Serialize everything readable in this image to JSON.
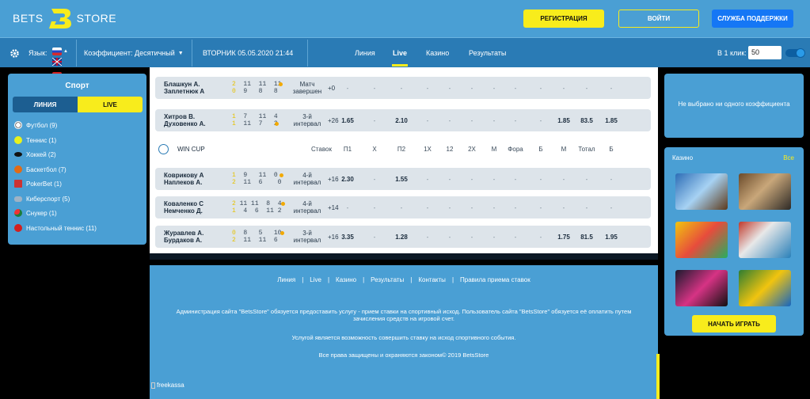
{
  "header": {
    "logo_left": "BETS",
    "logo_right": "STORE",
    "register_label": "РЕГИСТРАЦИЯ",
    "login_label": "ВОЙТИ",
    "support_label": "СЛУЖБА ПОДДЕРЖКИ",
    "colors": {
      "accent": "#f8ec1c",
      "header_bg": "#4a9fd4",
      "nav_bg": "#2a7bb5",
      "support": "#1577f5"
    }
  },
  "nav": {
    "language_label": "Язык:",
    "coef_label": "Коэффициент:",
    "coef_value": "Десятичный",
    "datetime": "ВТОРНИК 05.05.2020 21:44",
    "tabs": [
      {
        "label": "Линия"
      },
      {
        "label": "Live"
      },
      {
        "label": "Казино"
      },
      {
        "label": "Результаты"
      }
    ],
    "one_click_label": "В 1 клик:",
    "one_click_value": "50"
  },
  "sport_panel": {
    "title": "Спорт",
    "tabs": [
      "ЛИНИЯ",
      "LIVE"
    ],
    "items": [
      {
        "label": "Футбол (9)",
        "icon": "football-icon"
      },
      {
        "label": "Теннис (1)",
        "icon": "tennis-icon"
      },
      {
        "label": "Хоккей (2)",
        "icon": "hockey-icon"
      },
      {
        "label": "Баскетбол (7)",
        "icon": "basketball-icon"
      },
      {
        "label": "PokerBet (1)",
        "icon": "poker-icon"
      },
      {
        "label": "Киберспорт (5)",
        "icon": "esports-icon"
      },
      {
        "label": "Снукер (1)",
        "icon": "snooker-icon"
      },
      {
        "label": "Настольный теннис (11)",
        "icon": "table-tennis-icon"
      }
    ]
  },
  "events": [
    {
      "team1": "Блашкун А.",
      "team2": "Заплетнюк А",
      "score1": [
        "2",
        "11",
        "11",
        "11"
      ],
      "score2": [
        "0",
        "9",
        "8",
        "8"
      ],
      "period": "Матч завершен",
      "more": "+0",
      "odds": [
        "-",
        "-",
        "-",
        "-",
        "-",
        "-",
        "-",
        "-",
        "-",
        "-",
        "-",
        "-"
      ]
    },
    {
      "team1": "Хитров В.",
      "team2": "Духовенко А.",
      "score1": [
        "1",
        "7",
        "11",
        "4"
      ],
      "score2": [
        "1",
        "11",
        "7",
        "2"
      ],
      "period": "3-й интервал",
      "more": "+26",
      "odds": [
        "1.65",
        "-",
        "2.10",
        "-",
        "-",
        "-",
        "-",
        "-",
        "-",
        "1.85",
        "83.5",
        "1.85"
      ]
    },
    {
      "team1": "Коврикову А",
      "team2": "Наплеков А.",
      "score1": [
        "1",
        "9",
        "11",
        "0"
      ],
      "score2": [
        "2",
        "11",
        "6",
        "0"
      ],
      "period": "4-й интервал",
      "more": "+16",
      "odds": [
        "2.30",
        "-",
        "1.55",
        "-",
        "-",
        "-",
        "-",
        "-",
        "-",
        "-",
        "-",
        "-"
      ]
    },
    {
      "team1": "Коваленко С",
      "team2": "Немченко Д.",
      "score1": [
        "2",
        "11",
        "11",
        "8",
        "4"
      ],
      "score2": [
        "1",
        "4",
        "6",
        "11",
        "2"
      ],
      "period": "4-й интервал",
      "more": "+14",
      "odds": [
        "-",
        "-",
        "-",
        "-",
        "-",
        "-",
        "-",
        "-",
        "-",
        "-",
        "-",
        "-"
      ]
    },
    {
      "team1": "Журавлев А.",
      "team2": "Бурдаков А.",
      "score1": [
        "0",
        "8",
        "5",
        "10"
      ],
      "score2": [
        "2",
        "11",
        "11",
        "6"
      ],
      "period": "3-й интервал",
      "more": "+16",
      "odds": [
        "3.35",
        "-",
        "1.28",
        "-",
        "-",
        "-",
        "-",
        "-",
        "-",
        "1.75",
        "81.5",
        "1.95"
      ]
    }
  ],
  "cup": {
    "name": "WIN CUP",
    "headers": [
      "Ставок",
      "П1",
      "Х",
      "П2",
      "1Х",
      "12",
      "2Х",
      "М",
      "Фора",
      "Б",
      "М",
      "Тотал",
      "Б"
    ]
  },
  "coupon": {
    "empty_text": "Не выбрано ни одного коэффициента"
  },
  "casino": {
    "title": "Казино",
    "all_label": "Все",
    "games": [
      "",
      "",
      "",
      "",
      "",
      ""
    ],
    "play_label": "НАЧАТЬ ИГРАТЬ"
  },
  "footer": {
    "links": [
      "Линия",
      "Live",
      "Казино",
      "Результаты",
      "Контакты",
      "Правила приема ставок"
    ],
    "text1": "Администрация сайта \"BetsStore\" обязуется предоставить услугу - прием ставки на спортивный исход. Пользователь сайта \"BetsStore\" обязуется её оплатить путем зачисления средств на игровой счет.",
    "text2": "Услугой является возможность совершить ставку на исход спортивного события.",
    "text3": "Все права защищены и охраняются законом© 2019 BetsStore",
    "freekassa": "freekassa"
  }
}
